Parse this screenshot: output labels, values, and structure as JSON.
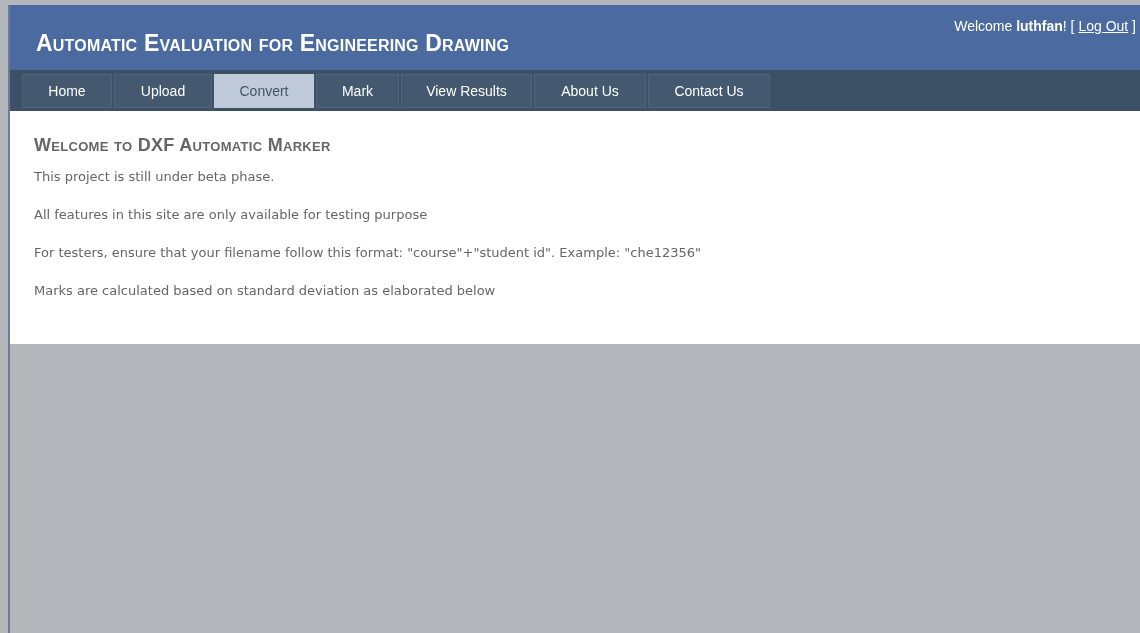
{
  "header": {
    "title": "Automatic Evaluation for Engineering Drawing",
    "welcome": {
      "text": "Welcome **luthfan**! [ ",
      "link": "Log Out",
      "suffix": " ]"
    }
  },
  "menu": [
    {
      "label": "Home",
      "selected": false
    },
    {
      "label": "Upload",
      "selected": false
    },
    {
      "label": "Convert",
      "selected": true
    },
    {
      "label": "Mark",
      "selected": false
    },
    {
      "label": "View Results",
      "selected": false
    },
    {
      "label": "About Us",
      "selected": false
    },
    {
      "label": "Contact Us",
      "selected": false
    }
  ],
  "content": {
    "heading": "Welcome to DXF Automatic Marker",
    "paragraphs": [
      "This project is still under beta phase.",
      "All features in this site are only available for testing purpose",
      "For testers, ensure that your filename follow this format: \"course\"+\"student id\". Example: \"che12356\"",
      "Marks are calculated based on standard deviation as elaborated below"
    ]
  }
}
